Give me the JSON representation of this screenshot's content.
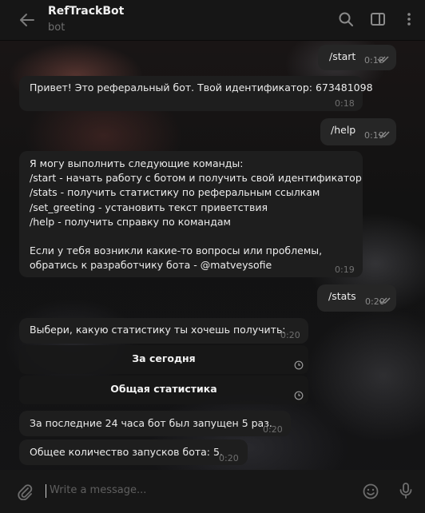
{
  "header": {
    "title": "RefTrackBot",
    "subtitle": "bot"
  },
  "messages": [
    {
      "dir": "out",
      "text": "/start",
      "time": "0:18"
    },
    {
      "dir": "in",
      "text": "Привет! Это реферальный бот. Твой идентификатор: 673481098",
      "time": "0:18"
    },
    {
      "dir": "out",
      "text": "/help",
      "time": "0:19"
    },
    {
      "dir": "in",
      "lines": [
        "Я могу выполнить следующие команды:",
        "/start - начать работу с ботом и получить свой идентификатор",
        "/stats - получить статистику по реферальным ссылкам",
        "/set_greeting - установить текст приветствия",
        "/help - получить справку по командам",
        "",
        "Если у тебя возникли какие-то вопросы или проблемы,",
        "обратись к разработчику бота - @matveysofie"
      ],
      "time": "0:19"
    },
    {
      "dir": "out",
      "text": "/stats",
      "time": "0:20"
    },
    {
      "dir": "in",
      "text": "Выбери, какую статистику ты хочешь получить:",
      "time": "0:20"
    },
    {
      "dir": "in",
      "text": "За последние 24 часа бот был запущен 5 раз.",
      "time": "0:20"
    },
    {
      "dir": "in",
      "text": "Общее количество запусков бота: 5.",
      "time": "0:20"
    }
  ],
  "keyboard": {
    "buttons": [
      "За сегодня",
      "Общая статистика"
    ]
  },
  "input": {
    "placeholder": "Write a message..."
  },
  "icons": {
    "back": "arrow-left-icon",
    "search": "search-icon",
    "sidebar": "sidebar-toggle-icon",
    "menu": "more-vertical-icon",
    "attach": "paperclip-icon",
    "emoji": "emoji-icon",
    "mic": "microphone-icon",
    "read": "double-check-icon",
    "pending": "clock-icon"
  },
  "colors": {
    "bubble_in": "#1e1e1e",
    "bubble_out": "#262626",
    "header": "#161616",
    "muted": "#6f6f6f"
  }
}
